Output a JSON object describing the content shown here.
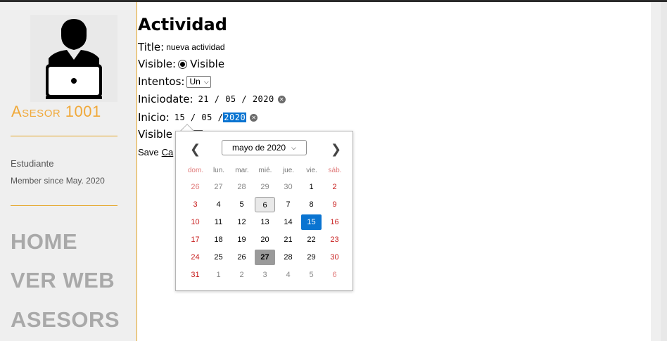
{
  "sidebar": {
    "site_name": "Asesor 1001",
    "role": "Estudiante",
    "member_since": "Member since May. 2020",
    "nav": [
      "HOME",
      "VER WEB",
      "ASESORS"
    ]
  },
  "form": {
    "heading": "Actividad",
    "title_label": "Title:",
    "title_value": "nueva actividad",
    "visible_label": "Visible:",
    "visible_option": "Visible",
    "intentos_label": "Intentos:",
    "intentos_value": "Un",
    "iniciodate_label": "Iniciodate:",
    "iniciodate_value": "21 / 05 / 2020",
    "inicio_label": "Inicio:",
    "inicio_day": "15",
    "inicio_month": "05",
    "inicio_year": "2020",
    "visible2_label": "Visible",
    "save_label": "Save",
    "cancel_label": "Ca"
  },
  "calendar": {
    "month_label": "mayo de 2020",
    "weekdays": [
      "dom.",
      "lun.",
      "mar.",
      "mié.",
      "jue.",
      "vie.",
      "sáb."
    ],
    "weeks": [
      [
        "26",
        "27",
        "28",
        "29",
        "30",
        "1",
        "2"
      ],
      [
        "3",
        "4",
        "5",
        "6",
        "7",
        "8",
        "9"
      ],
      [
        "10",
        "11",
        "12",
        "13",
        "14",
        "15",
        "16"
      ],
      [
        "17",
        "18",
        "19",
        "20",
        "21",
        "22",
        "23"
      ],
      [
        "24",
        "25",
        "26",
        "27",
        "28",
        "29",
        "30"
      ],
      [
        "31",
        "1",
        "2",
        "3",
        "4",
        "5",
        "6"
      ]
    ],
    "selected_day": "15",
    "today_day": "27",
    "focused_day": "6",
    "colors": {
      "weekend": "#c81e1e",
      "weekend_other": "#e07a7a",
      "other_month": "#888888",
      "selected_bg": "#0a74d1",
      "today_bg": "#9a9a9a",
      "focus_bg": "#e9e9e9"
    }
  }
}
